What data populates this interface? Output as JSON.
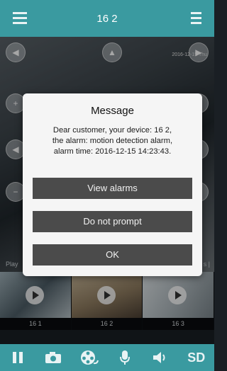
{
  "header": {
    "title": "16 2"
  },
  "video": {
    "timestamp": "2016-12-15 Thu",
    "left_watermark": "Play",
    "right_watermark": "s |"
  },
  "thumbnails": [
    {
      "label": "16 1"
    },
    {
      "label": "16 2",
      "selected": true
    },
    {
      "label": "16 3"
    }
  ],
  "dialog": {
    "title": "Message",
    "lines": [
      "Dear customer, your device: 16 2,",
      "the alarm: motion detection alarm,",
      "alarm time: 2016-12-15 14:23:43."
    ],
    "buttons": {
      "view_alarms": "View alarms",
      "do_not_prompt": "Do not prompt",
      "ok": "OK"
    }
  },
  "toolbar": {
    "sd_label": "SD",
    "icons": [
      "pause-icon",
      "camera-icon",
      "reel-icon",
      "microphone-icon",
      "speaker-icon"
    ]
  },
  "colors": {
    "accent": "#3a9aa0",
    "dialog_button": "#4b4b4b",
    "selected_border": "#c8a23a"
  }
}
